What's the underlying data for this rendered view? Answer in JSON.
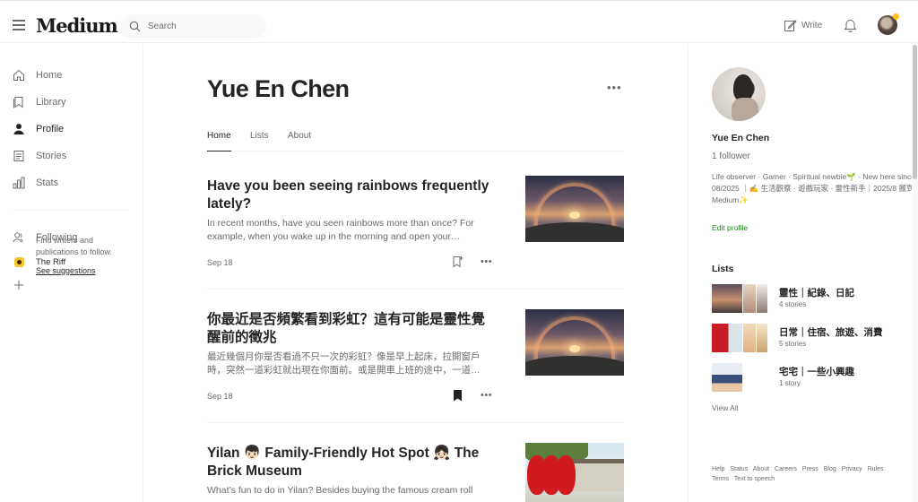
{
  "header": {
    "logo": "Medium",
    "search_placeholder": "Search",
    "write_label": "Write"
  },
  "sidebar": {
    "items": [
      {
        "label": "Home",
        "icon": "home-icon"
      },
      {
        "label": "Library",
        "icon": "bookmark-icon"
      },
      {
        "label": "Profile",
        "icon": "person-icon"
      },
      {
        "label": "Stories",
        "icon": "document-icon"
      },
      {
        "label": "Stats",
        "icon": "bar-chart-icon"
      }
    ],
    "following_label": "Following",
    "riff_label": "The Riff",
    "find_text": "Find writers and publications to follow.",
    "see_suggestions": "See suggestions"
  },
  "main": {
    "title": "Yue En Chen",
    "more_glyph": "•••",
    "tabs": [
      {
        "label": "Home",
        "active": true
      },
      {
        "label": "Lists",
        "active": false
      },
      {
        "label": "About",
        "active": false
      }
    ],
    "articles": [
      {
        "title": "Have you been seeing rainbows frequently lately?",
        "subtitle": "In recent months, have you seen rainbows more than once? For example, when you wake up in the morning and open your…",
        "date": "Sep 18",
        "saved": false,
        "thumb": "rainbow"
      },
      {
        "title": "你最近是否頻繁看到彩虹？這有可能是靈性覺醒前的徵兆",
        "subtitle": "最近幾個月你是否看過不只一次的彩虹？像是早上起床，拉開窗戶時，突然一道彩虹就出現在你面前。或是開車上班的途中，一道…",
        "date": "Sep 18",
        "saved": true,
        "thumb": "rainbow"
      },
      {
        "title": "Yilan 👦🏻 Family-Friendly Hot Spot 👧🏻 The Brick Museum",
        "subtitle": "What’s fun to do in Yilan? Besides buying the famous cream roll",
        "date": "",
        "saved": false,
        "thumb": "brick"
      }
    ],
    "more_glyph_small": "•••"
  },
  "profile": {
    "name": "Yue En Chen",
    "followers": "1 follower",
    "bio": "Life observer · Gamer · Spiritual newbie🌱 · New here since 08/2025 ｜✍️ 生活觀察 · 遊戲玩家 · 靈性新手｜2025/8 搬到 Medium✨",
    "edit_label": "Edit profile",
    "lists_heading": "Lists",
    "lists": [
      {
        "title": "靈性｜紀錄、日記",
        "count": "4 stories",
        "colors": [
          "#8a6f74",
          "#c89a7c",
          "#7d6e66"
        ]
      },
      {
        "title": "日常｜住宿、旅遊、消費",
        "count": "5 stories",
        "colors": [
          "#c41d23",
          "#e9c9b0",
          "#d8a96f"
        ]
      },
      {
        "title": "宅宅｜一些小興趣",
        "count": "1 story",
        "colors": [
          "#e8eef4",
          "#ffffff",
          "#ffffff"
        ]
      }
    ],
    "view_all": "View All",
    "footer_links": [
      "Help",
      "Status",
      "About",
      "Careers",
      "Press",
      "Blog",
      "Privacy",
      "Rules",
      "Terms",
      "Text to speech"
    ]
  }
}
